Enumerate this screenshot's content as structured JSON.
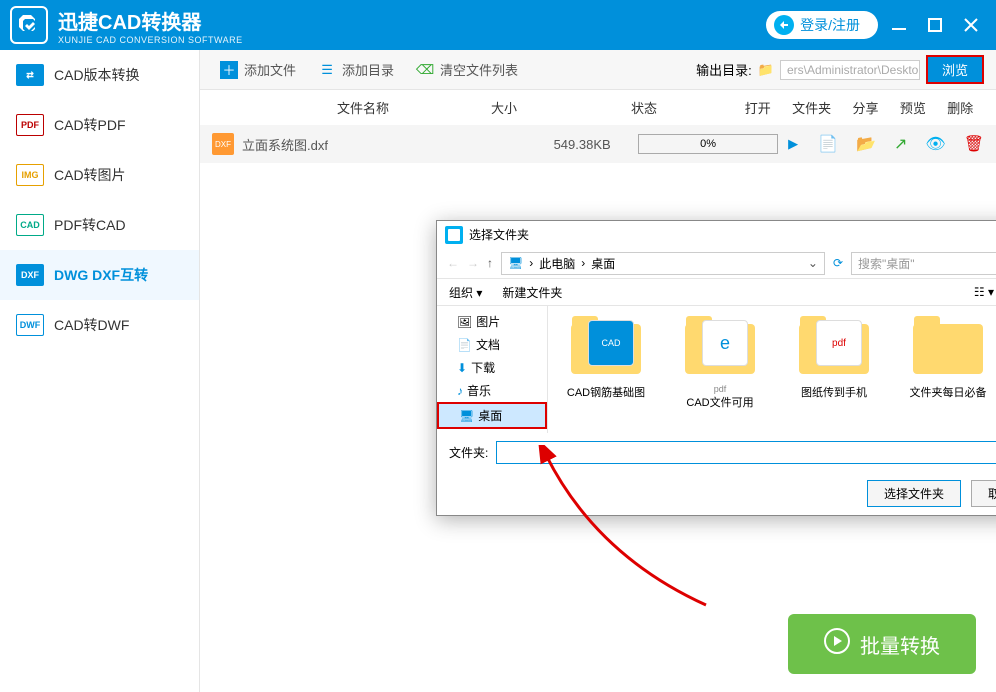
{
  "header": {
    "title": "迅捷CAD转换器",
    "subtitle": "XUNJIE CAD CONVERSION SOFTWARE",
    "login": "登录/注册"
  },
  "sidebar": {
    "items": [
      {
        "label": "CAD版本转换"
      },
      {
        "label": "CAD转PDF"
      },
      {
        "label": "CAD转图片"
      },
      {
        "label": "PDF转CAD"
      },
      {
        "label": "DWG DXF互转"
      },
      {
        "label": "CAD转DWF"
      }
    ]
  },
  "toolbar": {
    "add_file": "添加文件",
    "add_dir": "添加目录",
    "clear_list": "清空文件列表",
    "output_label": "输出目录:",
    "output_path": "ers\\Administrator\\Desktop",
    "browse": "浏览"
  },
  "columns": {
    "name": "文件名称",
    "size": "大小",
    "status": "状态",
    "open": "打开",
    "folder": "文件夹",
    "share": "分享",
    "preview": "预览",
    "delete": "删除"
  },
  "files": [
    {
      "name": "立面系统图.dxf",
      "size": "549.38KB",
      "progress": "0%"
    }
  ],
  "batch_convert": "批量转换",
  "dialog": {
    "title": "选择文件夹",
    "path_root": "此电脑",
    "path_leaf": "桌面",
    "search_placeholder": "搜索\"桌面\"",
    "organize": "组织",
    "new_folder": "新建文件夹",
    "tree": [
      {
        "label": "图片"
      },
      {
        "label": "文档"
      },
      {
        "label": "下载"
      },
      {
        "label": "音乐"
      },
      {
        "label": "桌面"
      }
    ],
    "folders": [
      {
        "label": "CAD钢筋基础图"
      },
      {
        "label": "CAD文件可用"
      },
      {
        "label": "图纸传到手机"
      },
      {
        "label": "文件夹每日必备"
      }
    ],
    "folder_label": "文件夹:",
    "select_btn": "选择文件夹",
    "cancel_btn": "取消"
  }
}
